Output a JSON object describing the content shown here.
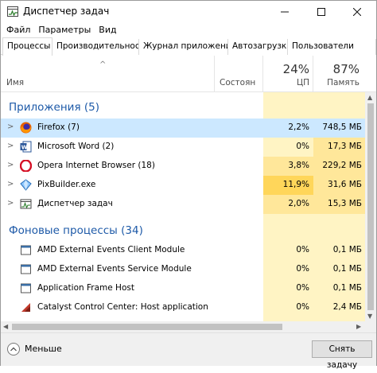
{
  "window": {
    "title": "Диспетчер задач"
  },
  "menu": [
    "Файл",
    "Параметры",
    "Вид"
  ],
  "tabs": [
    "Процессы",
    "Производительность",
    "Журнал приложений",
    "Автозагрузка",
    "Пользователи"
  ],
  "columns": {
    "name": "Имя",
    "status": "Состоян",
    "cpu_percent": "24%",
    "cpu": "ЦП",
    "memory_percent": "87%",
    "memory": "Память"
  },
  "groups": {
    "apps": "Приложения (5)",
    "background": "Фоновые процессы (34)"
  },
  "apps": [
    {
      "name": "Firefox (7)",
      "cpu": "2,2%",
      "memory": "748,5 МБ",
      "icon": "firefox-icon"
    },
    {
      "name": "Microsoft Word (2)",
      "cpu": "0%",
      "memory": "17,3 МБ",
      "icon": "word-icon"
    },
    {
      "name": "Opera Internet Browser (18)",
      "cpu": "3,8%",
      "memory": "229,2 МБ",
      "icon": "opera-icon"
    },
    {
      "name": "PixBuilder.exe",
      "cpu": "11,9%",
      "memory": "31,6 МБ",
      "icon": "pixbuilder-icon"
    },
    {
      "name": "Диспетчер задач",
      "cpu": "2,0%",
      "memory": "15,3 МБ",
      "icon": "task-manager-icon"
    }
  ],
  "background": [
    {
      "name": "AMD External Events Client Module",
      "cpu": "0%",
      "memory": "0,1 МБ",
      "icon": "service-icon"
    },
    {
      "name": "AMD External Events Service Module",
      "cpu": "0%",
      "memory": "0,1 МБ",
      "icon": "service-icon"
    },
    {
      "name": "Application Frame Host",
      "cpu": "0%",
      "memory": "0,1 МБ",
      "icon": "service-icon"
    },
    {
      "name": "Catalyst Control Center: Host application",
      "cpu": "0%",
      "memory": "2,4 МБ",
      "icon": "catalyst-icon"
    }
  ],
  "footer": {
    "less": "Меньше",
    "end_task": "Снять задачу"
  },
  "colors": {
    "heat_light": "#fff4c4",
    "heat_medium": "#ffe79a",
    "heat_strong": "#ffd65a",
    "selected": "#cce8ff",
    "group_title": "#1e5aa8"
  }
}
